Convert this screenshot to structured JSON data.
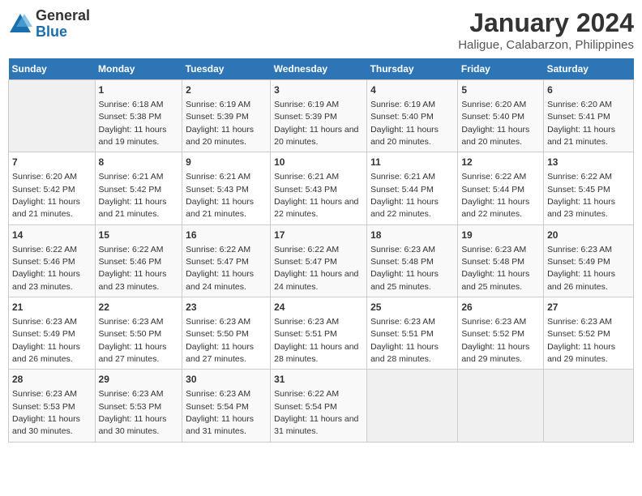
{
  "logo": {
    "general": "General",
    "blue": "Blue"
  },
  "title": "January 2024",
  "subtitle": "Haligue, Calabarzon, Philippines",
  "days_of_week": [
    "Sunday",
    "Monday",
    "Tuesday",
    "Wednesday",
    "Thursday",
    "Friday",
    "Saturday"
  ],
  "weeks": [
    [
      {
        "day": "",
        "sunrise": "",
        "sunset": "",
        "daylight": ""
      },
      {
        "day": "1",
        "sunrise": "Sunrise: 6:18 AM",
        "sunset": "Sunset: 5:38 PM",
        "daylight": "Daylight: 11 hours and 19 minutes."
      },
      {
        "day": "2",
        "sunrise": "Sunrise: 6:19 AM",
        "sunset": "Sunset: 5:39 PM",
        "daylight": "Daylight: 11 hours and 20 minutes."
      },
      {
        "day": "3",
        "sunrise": "Sunrise: 6:19 AM",
        "sunset": "Sunset: 5:39 PM",
        "daylight": "Daylight: 11 hours and 20 minutes."
      },
      {
        "day": "4",
        "sunrise": "Sunrise: 6:19 AM",
        "sunset": "Sunset: 5:40 PM",
        "daylight": "Daylight: 11 hours and 20 minutes."
      },
      {
        "day": "5",
        "sunrise": "Sunrise: 6:20 AM",
        "sunset": "Sunset: 5:40 PM",
        "daylight": "Daylight: 11 hours and 20 minutes."
      },
      {
        "day": "6",
        "sunrise": "Sunrise: 6:20 AM",
        "sunset": "Sunset: 5:41 PM",
        "daylight": "Daylight: 11 hours and 21 minutes."
      }
    ],
    [
      {
        "day": "7",
        "sunrise": "Sunrise: 6:20 AM",
        "sunset": "Sunset: 5:42 PM",
        "daylight": "Daylight: 11 hours and 21 minutes."
      },
      {
        "day": "8",
        "sunrise": "Sunrise: 6:21 AM",
        "sunset": "Sunset: 5:42 PM",
        "daylight": "Daylight: 11 hours and 21 minutes."
      },
      {
        "day": "9",
        "sunrise": "Sunrise: 6:21 AM",
        "sunset": "Sunset: 5:43 PM",
        "daylight": "Daylight: 11 hours and 21 minutes."
      },
      {
        "day": "10",
        "sunrise": "Sunrise: 6:21 AM",
        "sunset": "Sunset: 5:43 PM",
        "daylight": "Daylight: 11 hours and 22 minutes."
      },
      {
        "day": "11",
        "sunrise": "Sunrise: 6:21 AM",
        "sunset": "Sunset: 5:44 PM",
        "daylight": "Daylight: 11 hours and 22 minutes."
      },
      {
        "day": "12",
        "sunrise": "Sunrise: 6:22 AM",
        "sunset": "Sunset: 5:44 PM",
        "daylight": "Daylight: 11 hours and 22 minutes."
      },
      {
        "day": "13",
        "sunrise": "Sunrise: 6:22 AM",
        "sunset": "Sunset: 5:45 PM",
        "daylight": "Daylight: 11 hours and 23 minutes."
      }
    ],
    [
      {
        "day": "14",
        "sunrise": "Sunrise: 6:22 AM",
        "sunset": "Sunset: 5:46 PM",
        "daylight": "Daylight: 11 hours and 23 minutes."
      },
      {
        "day": "15",
        "sunrise": "Sunrise: 6:22 AM",
        "sunset": "Sunset: 5:46 PM",
        "daylight": "Daylight: 11 hours and 23 minutes."
      },
      {
        "day": "16",
        "sunrise": "Sunrise: 6:22 AM",
        "sunset": "Sunset: 5:47 PM",
        "daylight": "Daylight: 11 hours and 24 minutes."
      },
      {
        "day": "17",
        "sunrise": "Sunrise: 6:22 AM",
        "sunset": "Sunset: 5:47 PM",
        "daylight": "Daylight: 11 hours and 24 minutes."
      },
      {
        "day": "18",
        "sunrise": "Sunrise: 6:23 AM",
        "sunset": "Sunset: 5:48 PM",
        "daylight": "Daylight: 11 hours and 25 minutes."
      },
      {
        "day": "19",
        "sunrise": "Sunrise: 6:23 AM",
        "sunset": "Sunset: 5:48 PM",
        "daylight": "Daylight: 11 hours and 25 minutes."
      },
      {
        "day": "20",
        "sunrise": "Sunrise: 6:23 AM",
        "sunset": "Sunset: 5:49 PM",
        "daylight": "Daylight: 11 hours and 26 minutes."
      }
    ],
    [
      {
        "day": "21",
        "sunrise": "Sunrise: 6:23 AM",
        "sunset": "Sunset: 5:49 PM",
        "daylight": "Daylight: 11 hours and 26 minutes."
      },
      {
        "day": "22",
        "sunrise": "Sunrise: 6:23 AM",
        "sunset": "Sunset: 5:50 PM",
        "daylight": "Daylight: 11 hours and 27 minutes."
      },
      {
        "day": "23",
        "sunrise": "Sunrise: 6:23 AM",
        "sunset": "Sunset: 5:50 PM",
        "daylight": "Daylight: 11 hours and 27 minutes."
      },
      {
        "day": "24",
        "sunrise": "Sunrise: 6:23 AM",
        "sunset": "Sunset: 5:51 PM",
        "daylight": "Daylight: 11 hours and 28 minutes."
      },
      {
        "day": "25",
        "sunrise": "Sunrise: 6:23 AM",
        "sunset": "Sunset: 5:51 PM",
        "daylight": "Daylight: 11 hours and 28 minutes."
      },
      {
        "day": "26",
        "sunrise": "Sunrise: 6:23 AM",
        "sunset": "Sunset: 5:52 PM",
        "daylight": "Daylight: 11 hours and 29 minutes."
      },
      {
        "day": "27",
        "sunrise": "Sunrise: 6:23 AM",
        "sunset": "Sunset: 5:52 PM",
        "daylight": "Daylight: 11 hours and 29 minutes."
      }
    ],
    [
      {
        "day": "28",
        "sunrise": "Sunrise: 6:23 AM",
        "sunset": "Sunset: 5:53 PM",
        "daylight": "Daylight: 11 hours and 30 minutes."
      },
      {
        "day": "29",
        "sunrise": "Sunrise: 6:23 AM",
        "sunset": "Sunset: 5:53 PM",
        "daylight": "Daylight: 11 hours and 30 minutes."
      },
      {
        "day": "30",
        "sunrise": "Sunrise: 6:23 AM",
        "sunset": "Sunset: 5:54 PM",
        "daylight": "Daylight: 11 hours and 31 minutes."
      },
      {
        "day": "31",
        "sunrise": "Sunrise: 6:22 AM",
        "sunset": "Sunset: 5:54 PM",
        "daylight": "Daylight: 11 hours and 31 minutes."
      },
      {
        "day": "",
        "sunrise": "",
        "sunset": "",
        "daylight": ""
      },
      {
        "day": "",
        "sunrise": "",
        "sunset": "",
        "daylight": ""
      },
      {
        "day": "",
        "sunrise": "",
        "sunset": "",
        "daylight": ""
      }
    ]
  ]
}
